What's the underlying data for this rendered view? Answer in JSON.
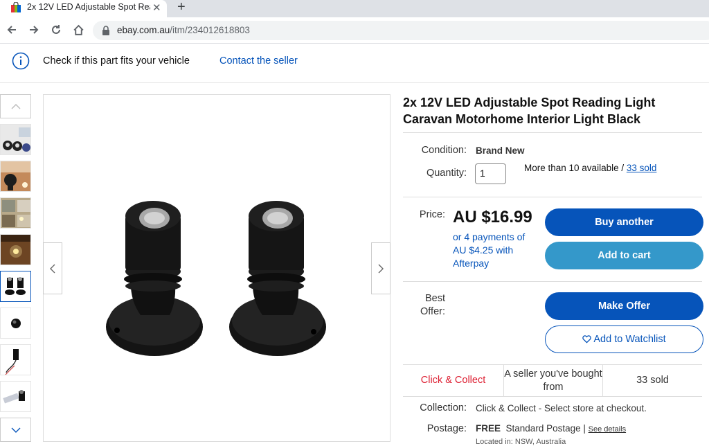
{
  "browser": {
    "tab_title": "2x 12V LED Adjustable Spot Reading Light Caravan Motorhome Interior Light Black",
    "new_tab": "+",
    "close": "✕",
    "url_domain": "ebay.com.au",
    "url_path": "/itm/234012618803"
  },
  "fitment": {
    "text": "Check if this part fits your vehicle",
    "contact": "Contact the seller"
  },
  "listing": {
    "title": "2x 12V LED Adjustable Spot Reading Light Caravan Motorhome Interior Light Black",
    "condition_label": "Condition:",
    "condition_value": "Brand New",
    "quantity_label": "Quantity:",
    "quantity_value": "1",
    "availability": "More than 10 available /",
    "sold_link": "33 sold",
    "price_label": "Price:",
    "price": "AU $16.99",
    "afterpay": "or 4 payments of AU $4.25 with Afterpay",
    "buy_button": "Buy another",
    "cart_button": "Add to cart",
    "best_offer_label_1": "Best",
    "best_offer_label_2": "Offer:",
    "offer_button": "Make Offer",
    "watchlist_button": "Add to Watchlist",
    "badge_collect": "Click & Collect",
    "badge_seller": "A seller you've bought from",
    "badge_sold": "33 sold",
    "collection_label": "Collection:",
    "collection_value": "Click & Collect - Select store at checkout.",
    "postage_label": "Postage:",
    "postage_free": "FREE",
    "postage_value": "Standard Postage |",
    "see_details": "See details",
    "located": "Located in:  NSW, Australia"
  },
  "colors": {
    "primary": "#0654ba",
    "secondary": "#3498ca",
    "collect": "#dd1e31"
  }
}
